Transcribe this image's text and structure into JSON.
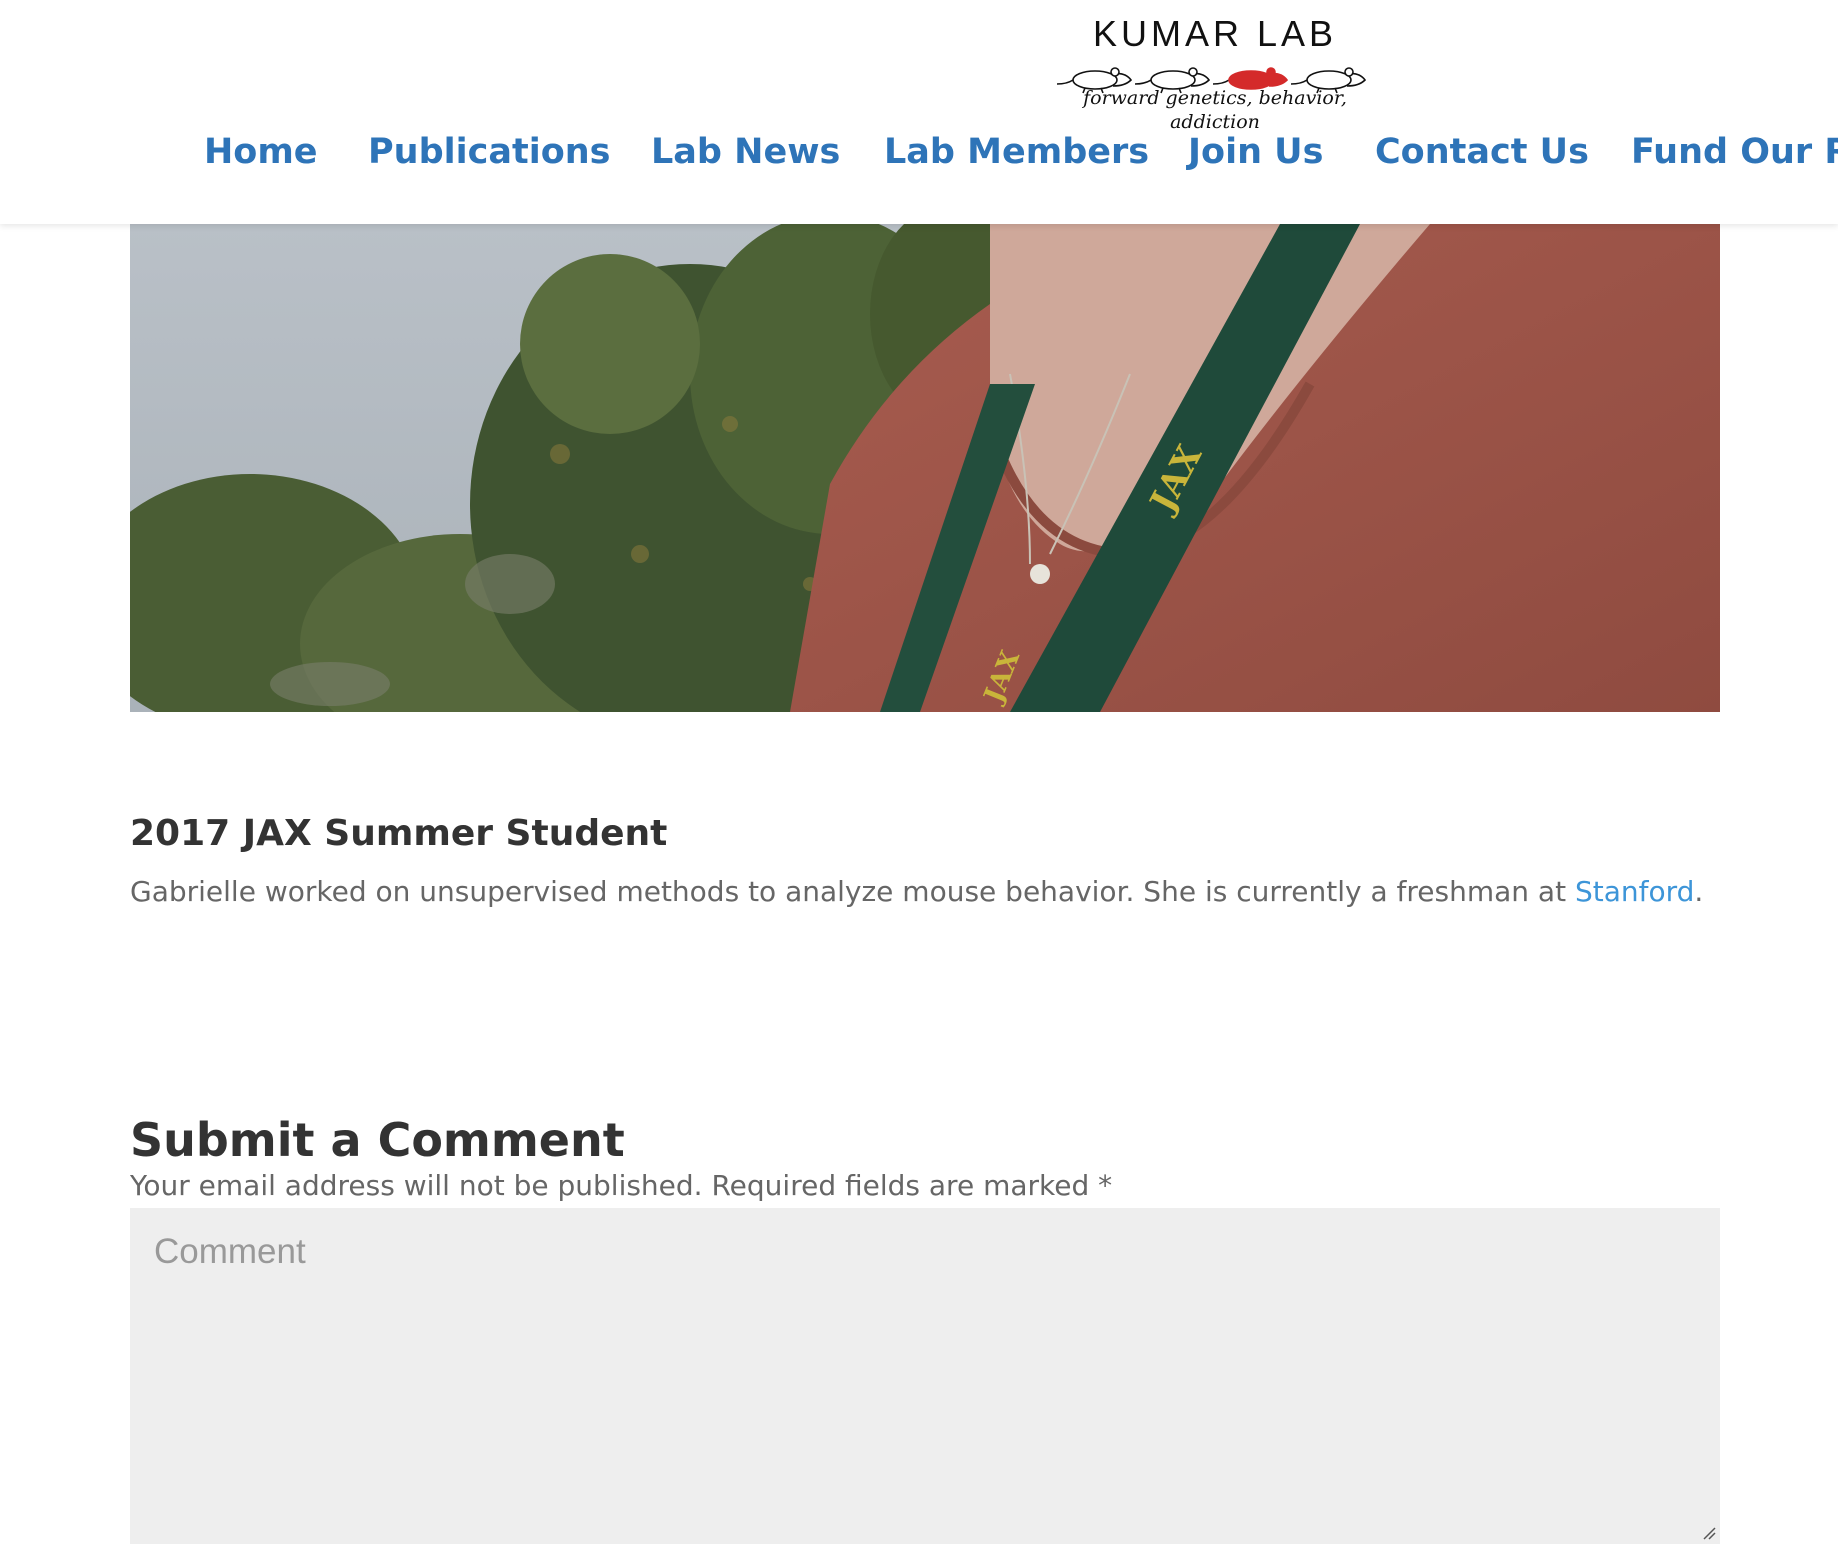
{
  "header": {
    "logo": {
      "name": "KUMAR LAB",
      "tagline": "forward genetics, behavior, addiction"
    },
    "nav": [
      {
        "label": "Home"
      },
      {
        "label": "Publications"
      },
      {
        "label": "Lab News"
      },
      {
        "label": "Lab Members"
      },
      {
        "label": "Join Us"
      },
      {
        "label": "Contact Us"
      },
      {
        "label": "Fund Our R"
      }
    ]
  },
  "member": {
    "title": "2017 JAX Summer Student",
    "bio_text": "Gabrielle worked on unsupervised methods to analyze mouse behavior. She is currently a freshman at ",
    "bio_link": "Stanford",
    "bio_end": "."
  },
  "comments": {
    "heading": "Submit a Comment",
    "note": "Your email address will not be published. Required fields are marked *",
    "placeholder": "Comment"
  },
  "colors": {
    "nav_link": "#2e74b8",
    "body_link": "#3d95d8",
    "logo_accent_mouse": "#d42a2a",
    "textarea_bg": "#eeeeee"
  }
}
